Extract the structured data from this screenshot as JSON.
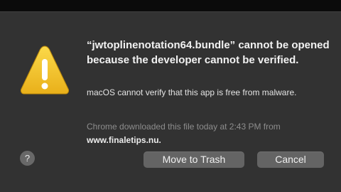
{
  "dialog": {
    "title": "“jwtoplinenotation64.bundle” cannot be opened because the developer cannot be verified.",
    "message": "macOS cannot verify that this app is free from malware.",
    "download_note": "Chrome downloaded this file today at 2:43 PM from",
    "download_site": "www.finaletips.nu.",
    "help_label": "?",
    "primary_button_label": "Move to Trash",
    "cancel_button_label": "Cancel",
    "icon": "warning-icon"
  },
  "colors": {
    "dialog_background": "#323232",
    "button_background": "#646464",
    "warning_yellow": "#f5c52b",
    "muted_text": "#8d8d8d"
  }
}
